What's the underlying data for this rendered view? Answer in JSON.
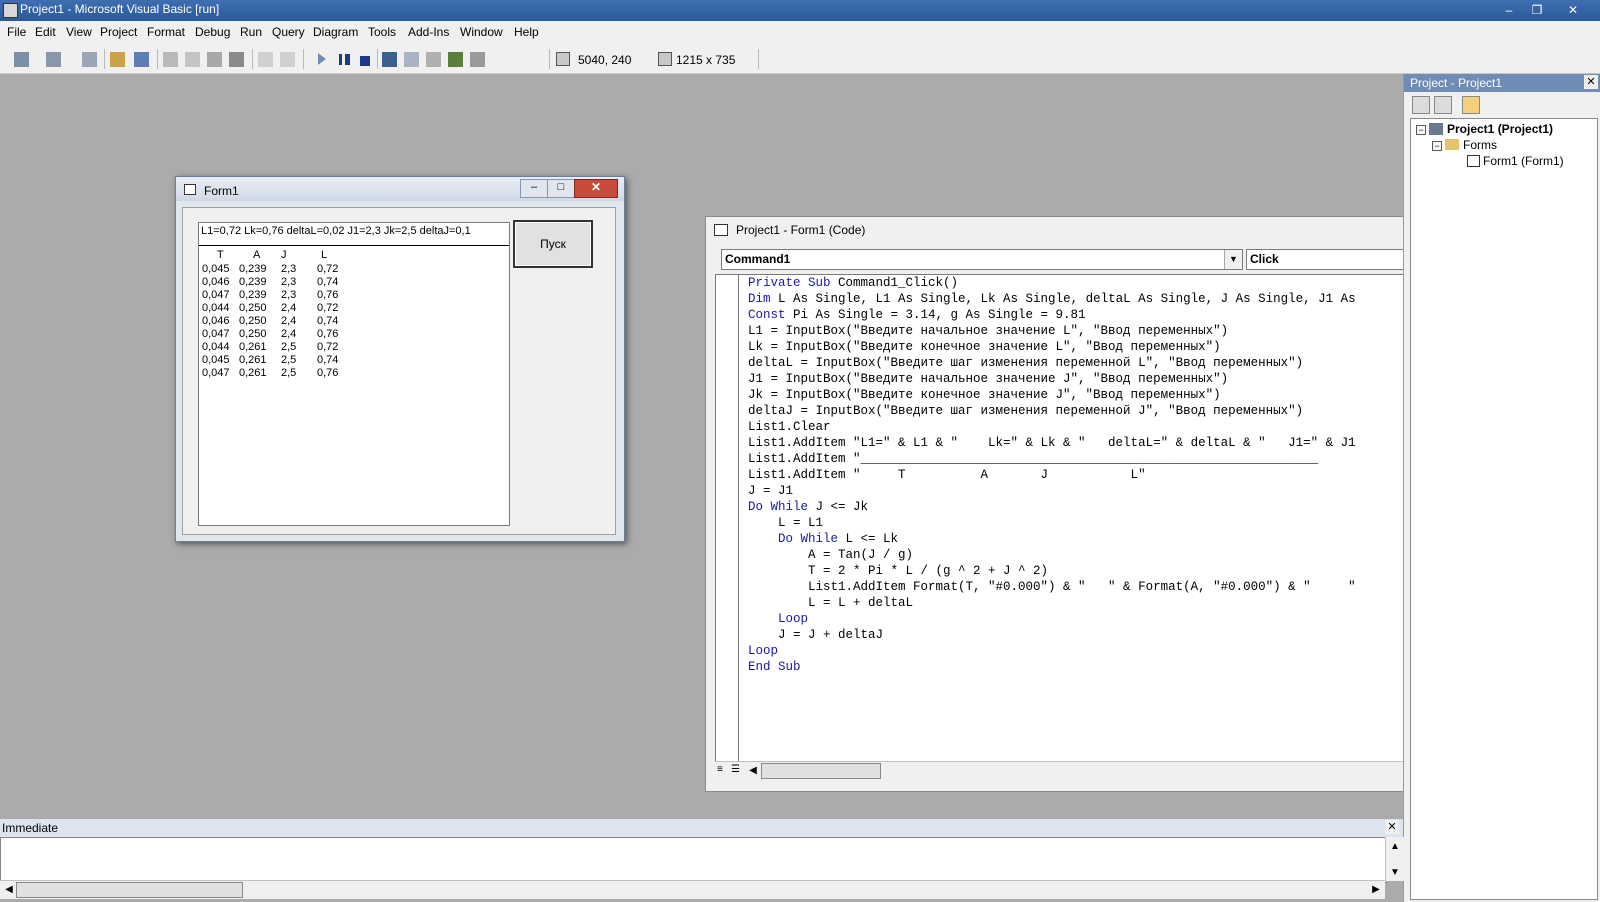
{
  "window": {
    "title": "Project1 - Microsoft Visual Basic [run]"
  },
  "menu": {
    "items": [
      "File",
      "Edit",
      "View",
      "Project",
      "Format",
      "Debug",
      "Run",
      "Query",
      "Diagram",
      "Tools",
      "Add-Ins",
      "Window",
      "Help"
    ]
  },
  "toolbar": {
    "position": "5040, 240",
    "size": "1215 x 735"
  },
  "form1": {
    "title": "Form1",
    "button_label": "Пуск",
    "list_header": "L1=0,72   Lk=0,76   deltaL=0,02   J1=2,3   Jk=2,5   deltaJ=0,1",
    "list_columns": [
      "T",
      "A",
      "J",
      "L"
    ],
    "list_rows": [
      [
        "0,045",
        "0,239",
        "2,3",
        "0,72"
      ],
      [
        "0,046",
        "0,239",
        "2,3",
        "0,74"
      ],
      [
        "0,047",
        "0,239",
        "2,3",
        "0,76"
      ],
      [
        "0,044",
        "0,250",
        "2,4",
        "0,72"
      ],
      [
        "0,046",
        "0,250",
        "2,4",
        "0,74"
      ],
      [
        "0,047",
        "0,250",
        "2,4",
        "0,76"
      ],
      [
        "0,044",
        "0,261",
        "2,5",
        "0,72"
      ],
      [
        "0,045",
        "0,261",
        "2,5",
        "0,74"
      ],
      [
        "0,047",
        "0,261",
        "2,5",
        "0,76"
      ]
    ]
  },
  "code_window": {
    "title": "Project1 - Form1 (Code)",
    "object_combo": "Command1",
    "proc_combo": "Click",
    "lines": [
      {
        "kw": "Private Sub",
        "rest": " Command1_Click()"
      },
      {
        "kw": "Dim",
        "rest": " L As Single, L1 As Single, Lk As Single, deltaL As Single, J As Single, J1 As"
      },
      {
        "kw": "Const",
        "rest": " Pi As Single = 3.14, g As Single = 9.81"
      },
      {
        "kw": "",
        "rest": "L1 = InputBox(\"Введите начальное значение L\", \"Ввод переменных\")"
      },
      {
        "kw": "",
        "rest": "Lk = InputBox(\"Введите конечное значение L\", \"Ввод переменных\")"
      },
      {
        "kw": "",
        "rest": "deltaL = InputBox(\"Введите шаг изменения переменной L\", \"Ввод переменных\")"
      },
      {
        "kw": "",
        "rest": "J1 = InputBox(\"Введите начальное значение J\", \"Ввод переменных\")"
      },
      {
        "kw": "",
        "rest": "Jk = InputBox(\"Введите конечное значение J\", \"Ввод переменных\")"
      },
      {
        "kw": "",
        "rest": "deltaJ = InputBox(\"Введите шаг изменения переменной J\", \"Ввод переменных\")"
      },
      {
        "kw": "",
        "rest": "List1.Clear"
      },
      {
        "kw": "",
        "rest": "List1.AddItem \"L1=\" & L1 & \"    Lk=\" & Lk & \"   deltaL=\" & deltaL & \"   J1=\" & J1"
      },
      {
        "kw": "",
        "rest": "List1.AddItem \"_____________________________________________________________"
      },
      {
        "kw": "",
        "rest": "List1.AddItem \"     T          A       J           L\""
      },
      {
        "kw": "",
        "rest": "J = J1"
      },
      {
        "kw": "Do While",
        "rest": " J <= Jk"
      },
      {
        "kw": "",
        "rest": "    L = L1"
      },
      {
        "kw": "    Do While",
        "rest": " L <= Lk"
      },
      {
        "kw": "",
        "rest": "        A = Tan(J / g)"
      },
      {
        "kw": "",
        "rest": "        T = 2 * Pi * L / (g ^ 2 + J ^ 2)"
      },
      {
        "kw": "",
        "rest": "        List1.AddItem Format(T, \"#0.000\") & \"   \" & Format(A, \"#0.000\") & \"     \""
      },
      {
        "kw": "",
        "rest": "        L = L + deltaL"
      },
      {
        "kw": "    Loop",
        "rest": ""
      },
      {
        "kw": "",
        "rest": "    J = J + deltaJ"
      },
      {
        "kw": "Loop",
        "rest": ""
      },
      {
        "kw": "End Sub",
        "rest": ""
      }
    ]
  },
  "project_explorer": {
    "title": "Project - Project1",
    "root": "Project1 (Project1)",
    "folder": "Forms",
    "item": "Form1 (Form1)"
  },
  "immediate": {
    "title": "Immediate"
  },
  "colors": {
    "keyword": "#1a1a9e",
    "titlebar": "#2b5a9c"
  }
}
